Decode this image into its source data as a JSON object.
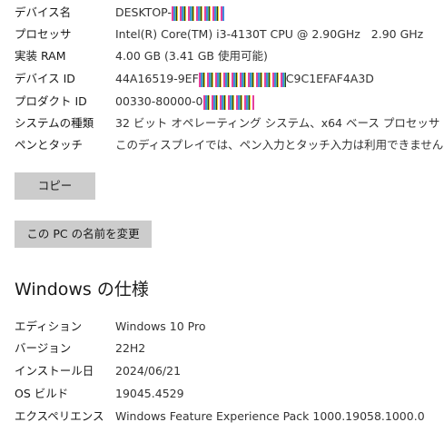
{
  "device_specs": {
    "items": [
      {
        "label": "デバイス名",
        "value_prefix": "DESKTOP-",
        "value_suffix": ""
      },
      {
        "label": "プロセッサ",
        "value": "Intel(R) Core(TM) i3-4130T CPU @ 2.90GHz   2.90 GHz"
      },
      {
        "label": "実装 RAM",
        "value": "4.00 GB (3.41 GB 使用可能)"
      },
      {
        "label": "デバイス ID",
        "value_prefix": "44A16519-9EF",
        "value_suffix": "C9C1EFAF4A3D"
      },
      {
        "label": "プロダクト ID",
        "value_prefix": "00330-80000-0",
        "value_suffix": ""
      },
      {
        "label": "システムの種類",
        "value": "32 ビット オペレーティング システム、x64 ベース プロセッサ"
      },
      {
        "label": "ペンとタッチ",
        "value": "このディスプレイでは、ペン入力とタッチ入力は利用できません"
      }
    ],
    "copy_button": "コピー",
    "rename_button": "この PC の名前を変更"
  },
  "windows_specs": {
    "title": "Windows の仕様",
    "items": [
      {
        "label": "エディション",
        "value": "Windows 10 Pro"
      },
      {
        "label": "バージョン",
        "value": "22H2"
      },
      {
        "label": "インストール日",
        "value": "2024/06/21"
      },
      {
        "label": "OS ビルド",
        "value": "19045.4529"
      },
      {
        "label": "エクスペリエンス",
        "value": "Windows Feature Experience Pack 1000.19058.1000.0"
      }
    ]
  }
}
